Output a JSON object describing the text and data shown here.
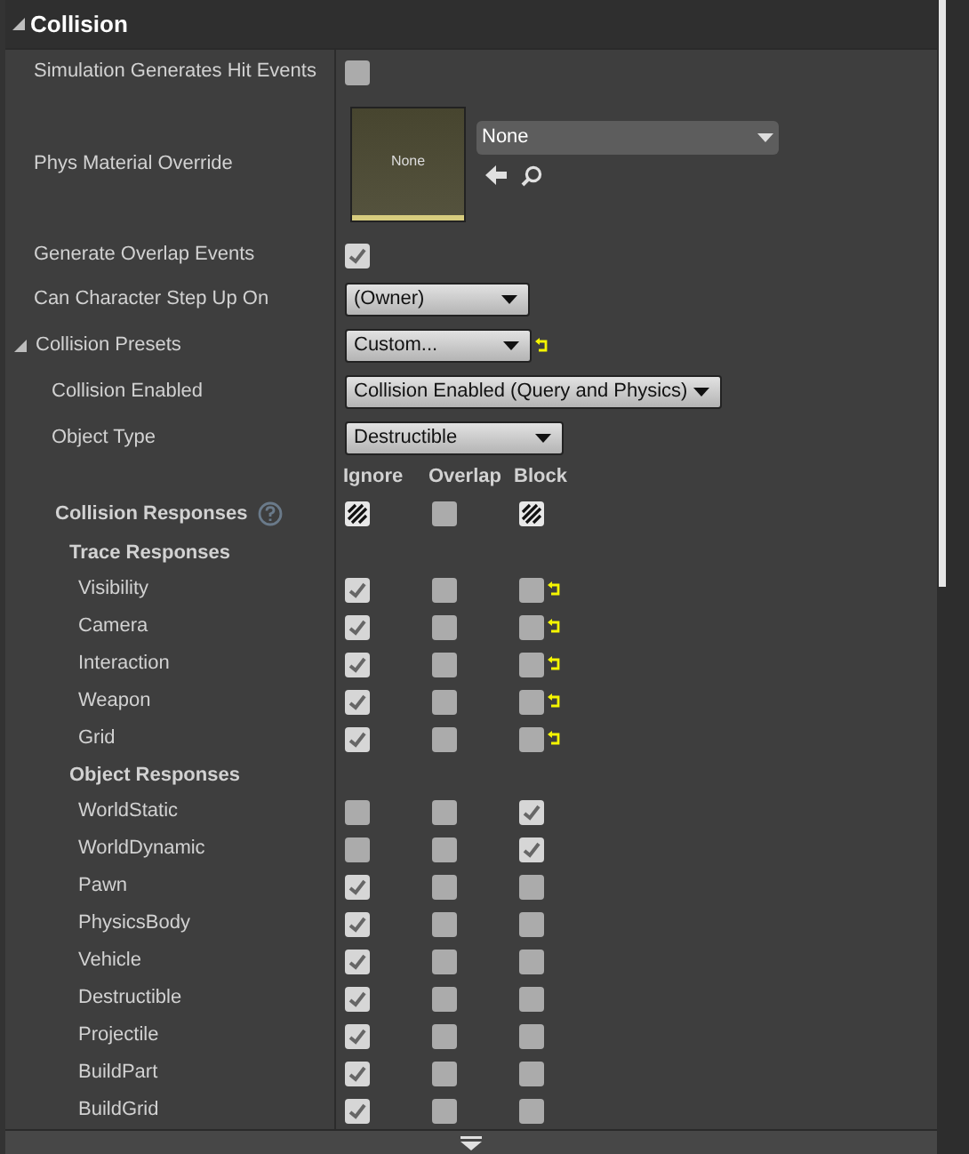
{
  "section": {
    "title": "Collision",
    "expanded": true
  },
  "properties": [
    {
      "kind": "checkbox",
      "label": "Simulation Generates Hit Events",
      "checked": false
    },
    {
      "kind": "asset",
      "label": "Phys Material Override",
      "thumbnail": "None",
      "value": "None"
    },
    {
      "kind": "checkbox",
      "label": "Generate Overlap Events",
      "checked": true
    },
    {
      "kind": "dropdown",
      "label": "Can Character Step Up On",
      "value": "(Owner)",
      "reset": false
    }
  ],
  "presets": {
    "label": "Collision Presets",
    "value": "Custom...",
    "reset": true,
    "expanded": true,
    "children": [
      {
        "label": "Collision Enabled",
        "value": "Collision Enabled (Query and Physics)"
      },
      {
        "label": "Object Type",
        "value": "Destructible"
      }
    ]
  },
  "responses": {
    "title": "Collision Responses",
    "columns": [
      "Ignore",
      "Overlap",
      "Block"
    ],
    "cells": [
      {
        "mixed": true
      },
      {
        "checked": false,
        "mixed": false
      },
      {
        "mixed": true
      }
    ],
    "groups": [
      {
        "title": "Trace Responses",
        "rows": [
          {
            "label": "Visibility",
            "cells": [
              {
                "checked": true,
                "mixed": false
              },
              {
                "checked": false,
                "mixed": false
              },
              {
                "checked": false,
                "mixed": false
              }
            ],
            "reset": true
          },
          {
            "label": "Camera",
            "cells": [
              {
                "checked": true,
                "mixed": false
              },
              {
                "checked": false,
                "mixed": false
              },
              {
                "checked": false,
                "mixed": false
              }
            ],
            "reset": true
          },
          {
            "label": "Interaction",
            "cells": [
              {
                "checked": true,
                "mixed": false
              },
              {
                "checked": false,
                "mixed": false
              },
              {
                "checked": false,
                "mixed": false
              }
            ],
            "reset": true
          },
          {
            "label": "Weapon",
            "cells": [
              {
                "checked": true,
                "mixed": false
              },
              {
                "checked": false,
                "mixed": false
              },
              {
                "checked": false,
                "mixed": false
              }
            ],
            "reset": true
          },
          {
            "label": "Grid",
            "cells": [
              {
                "checked": true,
                "mixed": false
              },
              {
                "checked": false,
                "mixed": false
              },
              {
                "checked": false,
                "mixed": false
              }
            ],
            "reset": true
          }
        ]
      },
      {
        "title": "Object Responses",
        "rows": [
          {
            "label": "WorldStatic",
            "cells": [
              {
                "checked": false,
                "mixed": false
              },
              {
                "checked": false,
                "mixed": false
              },
              {
                "checked": true,
                "mixed": false
              }
            ],
            "reset": false
          },
          {
            "label": "WorldDynamic",
            "cells": [
              {
                "checked": false,
                "mixed": false
              },
              {
                "checked": false,
                "mixed": false
              },
              {
                "checked": true,
                "mixed": false
              }
            ],
            "reset": false
          },
          {
            "label": "Pawn",
            "cells": [
              {
                "checked": true,
                "mixed": false
              },
              {
                "checked": false,
                "mixed": false
              },
              {
                "checked": false,
                "mixed": false
              }
            ],
            "reset": false
          },
          {
            "label": "PhysicsBody",
            "cells": [
              {
                "checked": true,
                "mixed": false
              },
              {
                "checked": false,
                "mixed": false
              },
              {
                "checked": false,
                "mixed": false
              }
            ],
            "reset": false
          },
          {
            "label": "Vehicle",
            "cells": [
              {
                "checked": true,
                "mixed": false
              },
              {
                "checked": false,
                "mixed": false
              },
              {
                "checked": false,
                "mixed": false
              }
            ],
            "reset": false
          },
          {
            "label": "Destructible",
            "cells": [
              {
                "checked": true,
                "mixed": false
              },
              {
                "checked": false,
                "mixed": false
              },
              {
                "checked": false,
                "mixed": false
              }
            ],
            "reset": false
          },
          {
            "label": "Projectile",
            "cells": [
              {
                "checked": true,
                "mixed": false
              },
              {
                "checked": false,
                "mixed": false
              },
              {
                "checked": false,
                "mixed": false
              }
            ],
            "reset": false
          },
          {
            "label": "BuildPart",
            "cells": [
              {
                "checked": true,
                "mixed": false
              },
              {
                "checked": false,
                "mixed": false
              },
              {
                "checked": false,
                "mixed": false
              }
            ],
            "reset": false
          },
          {
            "label": "BuildGrid",
            "cells": [
              {
                "checked": true,
                "mixed": false
              },
              {
                "checked": false,
                "mixed": false
              },
              {
                "checked": false,
                "mixed": false
              }
            ],
            "reset": false
          }
        ]
      }
    ]
  }
}
